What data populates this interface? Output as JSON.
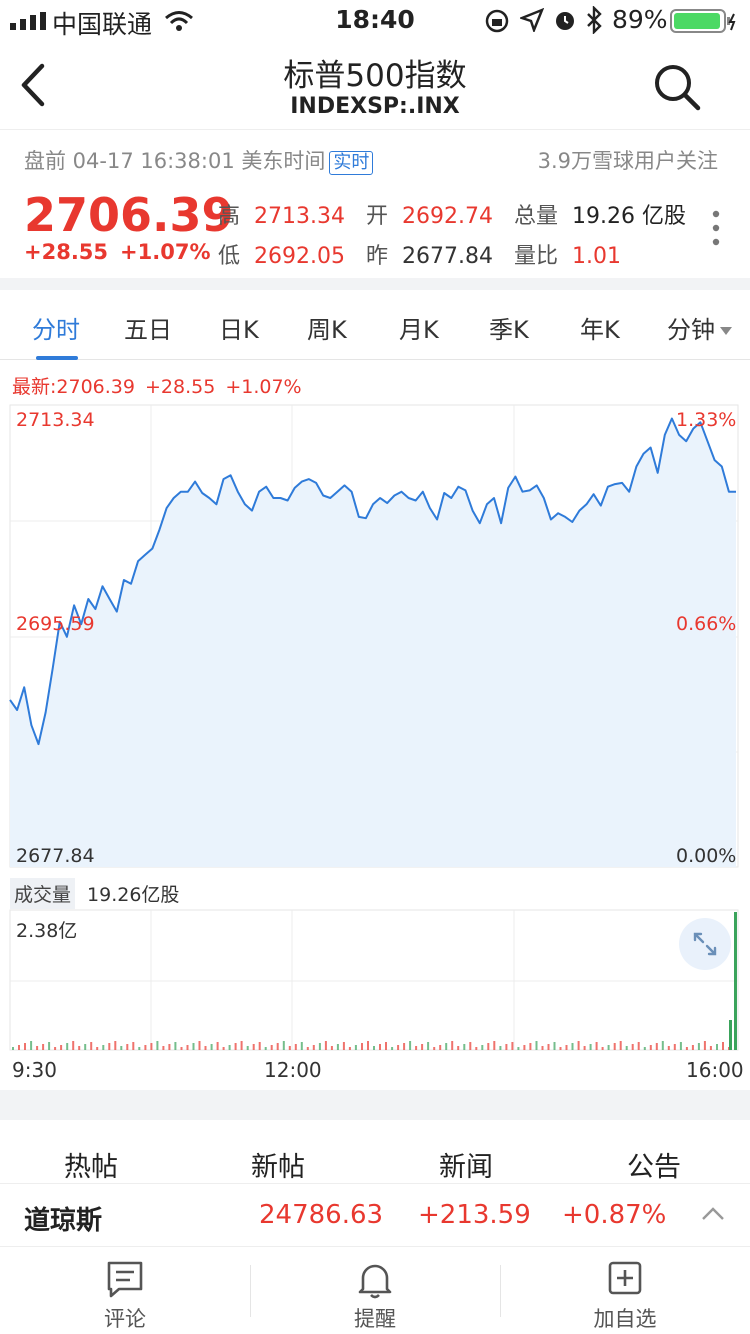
{
  "status_bar": {
    "carrier": "中国联通",
    "time": "18:40",
    "battery": "89%"
  },
  "nav": {
    "title": "标普500指数",
    "subtitle": "INDEXSP:.INX"
  },
  "info": {
    "session": "盘前 04-17 16:38:01 美东时间",
    "realtime_badge": "实时",
    "followers": "3.9万雪球用户关注",
    "price": "2706.39",
    "change": "+28.55",
    "change_pct": "+1.07%",
    "high_label": "高",
    "high": "2713.34",
    "open_label": "开",
    "open": "2692.74",
    "volume_label": "总量",
    "volume": "19.26 亿股",
    "low_label": "低",
    "low": "2692.05",
    "prev_label": "昨",
    "prev": "2677.84",
    "vol_ratio_label": "量比",
    "vol_ratio": "1.01"
  },
  "tabs": [
    "分时",
    "五日",
    "日K",
    "周K",
    "月K",
    "季K",
    "年K",
    "分钟"
  ],
  "latest": {
    "label": "最新:2706.39",
    "change": "+28.55",
    "pct": "+1.07%"
  },
  "axis": {
    "left_top": "2713.34",
    "left_mid": "2695.59",
    "left_bottom": "2677.84",
    "right_top": "1.33%",
    "right_mid": "0.66%",
    "right_bottom": "0.00%"
  },
  "volume": {
    "label": "成交量",
    "value": "19.26亿股",
    "max": "2.38亿"
  },
  "time_axis": [
    "9:30",
    "12:00",
    "16:00"
  ],
  "sections": [
    "热帖",
    "新帖",
    "新闻",
    "公告"
  ],
  "ticker": {
    "name": "道琼斯",
    "price": "24786.63",
    "change": "+213.59",
    "pct": "+0.87%"
  },
  "bottom_bar": [
    "评论",
    "提醒",
    "加自选"
  ],
  "colors": {
    "up": "#e8382f",
    "accent": "#2f7bd9",
    "line": "#2f7bd9",
    "fill": "#eaf3fc"
  },
  "chart_data": {
    "type": "line",
    "x": [
      "9:30",
      "16:00"
    ],
    "ylim": [
      2677.84,
      2713.34
    ],
    "values": [
      2691.0,
      2690.2,
      2692.0,
      2689.0,
      2687.5,
      2690.0,
      2693.5,
      2697.2,
      2696.0,
      2698.5,
      2697.0,
      2699.0,
      2698.2,
      2700.0,
      2699.0,
      2698.0,
      2700.5,
      2700.2,
      2702.0,
      2702.5,
      2703.0,
      2704.5,
      2706.2,
      2707.0,
      2707.5,
      2707.5,
      2708.3,
      2707.4,
      2707.0,
      2706.5,
      2708.5,
      2708.8,
      2707.5,
      2706.5,
      2706.0,
      2707.5,
      2707.9,
      2707.0,
      2707.0,
      2706.8,
      2707.8,
      2708.3,
      2708.5,
      2708.2,
      2707.2,
      2707.0,
      2707.5,
      2708.0,
      2707.5,
      2705.5,
      2705.4,
      2706.5,
      2707.0,
      2706.6,
      2707.2,
      2707.5,
      2707.0,
      2706.8,
      2707.5,
      2706.2,
      2705.3,
      2707.4,
      2707.0,
      2707.9,
      2707.6,
      2706.0,
      2705.0,
      2706.5,
      2707.0,
      2705.0,
      2707.8,
      2708.7,
      2707.5,
      2707.6,
      2708.0,
      2707.0,
      2705.3,
      2705.8,
      2705.5,
      2705.1,
      2706.0,
      2706.5,
      2707.3,
      2706.4,
      2707.9,
      2708.1,
      2708.2,
      2707.5,
      2709.5,
      2710.5,
      2711.0,
      2709.0,
      2712.0,
      2713.3,
      2712.0,
      2711.5,
      2712.5,
      2713.0,
      2711.5,
      2710.0,
      2709.5,
      2707.5,
      2707.5
    ]
  }
}
